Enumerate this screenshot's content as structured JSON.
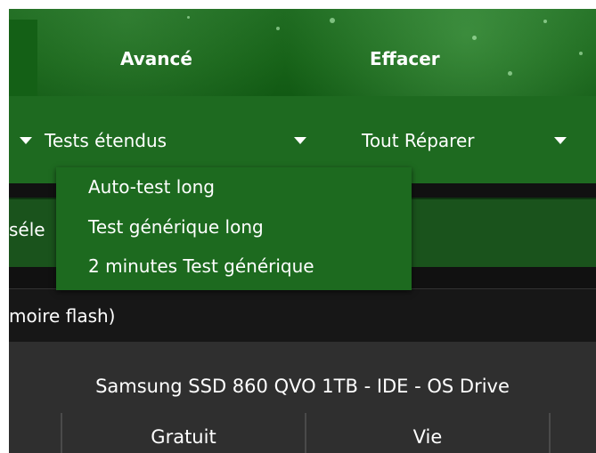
{
  "tabs": {
    "advanced": "Avancé",
    "erase": "Effacer"
  },
  "dropdowns": {
    "extended_tests": "Tests étendus",
    "repair_all": "Tout Réparer"
  },
  "menu": {
    "items": [
      "Auto-test long",
      "Test générique long",
      "2 minutes Test générique"
    ]
  },
  "select_row": {
    "label": "séle"
  },
  "flash_row": {
    "label": "moire flash)"
  },
  "drive": {
    "title": "Samsung SSD 860 QVO 1TB - IDE - OS Drive",
    "columns": [
      "Gratuit",
      "Vie"
    ]
  },
  "icons": {
    "dropdown": "triangle-down-icon"
  },
  "colors": {
    "header_green": "#1f6b21",
    "menu_green": "#1d6a1f",
    "panel_dark": "#2f2f2f"
  }
}
